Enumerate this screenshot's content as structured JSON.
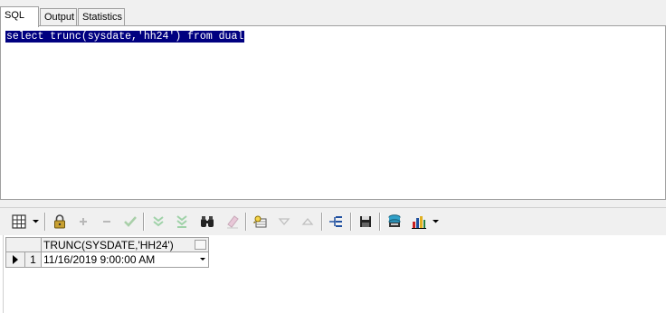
{
  "tabs": [
    {
      "label": "SQL",
      "active": true
    },
    {
      "label": "Output",
      "active": false
    },
    {
      "label": "Statistics",
      "active": false
    }
  ],
  "editor": {
    "sql_text": "select trunc(sysdate,'hh24') from dual",
    "selection_color": "#000080"
  },
  "toolbar": {
    "buttons": [
      {
        "name": "grid-layout-icon",
        "enabled": true
      },
      {
        "name": "lock-icon",
        "enabled": true
      },
      {
        "name": "add-record-icon",
        "enabled": false
      },
      {
        "name": "delete-record-icon",
        "enabled": false
      },
      {
        "name": "post-record-icon",
        "enabled": false
      },
      {
        "name": "fetch-next-page-icon",
        "enabled": false
      },
      {
        "name": "fetch-last-page-icon",
        "enabled": false
      },
      {
        "name": "find-binoculars-icon",
        "enabled": true
      },
      {
        "name": "clear-eraser-icon",
        "enabled": false
      },
      {
        "name": "query-by-example-icon",
        "enabled": true
      },
      {
        "name": "previous-record-icon",
        "enabled": false
      },
      {
        "name": "next-record-icon",
        "enabled": false
      },
      {
        "name": "record-view-icon",
        "enabled": true
      },
      {
        "name": "save-floppy-icon",
        "enabled": true
      },
      {
        "name": "export-data-icon",
        "enabled": true
      },
      {
        "name": "chart-icon",
        "enabled": true
      }
    ]
  },
  "grid": {
    "columns": [
      "TRUNC(SYSDATE,'HH24')"
    ],
    "rows": [
      {
        "num": "1",
        "values": [
          "11/16/2019 9:00:00 AM"
        ]
      }
    ]
  }
}
